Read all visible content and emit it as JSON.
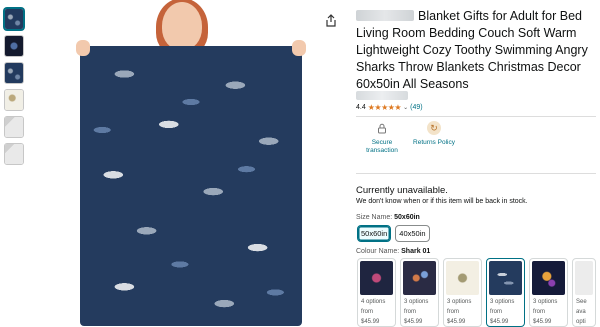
{
  "product": {
    "title": "Blanket Gifts for Adult for Bed Living Room Bedding Couch Soft Warm Lightweight Cozy Toothy Swimming Angry Sharks Throw Blankets Christmas Decor 60x50in All Seasons",
    "rating_value": "4.4",
    "rating_stars": "★★★★★",
    "rating_count": "(49)"
  },
  "thumbnails": [
    {
      "icon": "shark-blanket-thumb"
    },
    {
      "icon": "dark-blanket-thumb"
    },
    {
      "icon": "navy-blanket-thumb"
    },
    {
      "icon": "light-blanket-thumb"
    },
    {
      "icon": "grey-blanket-thumb"
    },
    {
      "icon": "detail-thumb"
    }
  ],
  "badges": {
    "secure": "Secure transaction",
    "returns": "Returns Policy"
  },
  "availability": {
    "status": "Currently unavailable.",
    "note": "We don't know when or if this item will be back in stock."
  },
  "size": {
    "label": "Size Name:",
    "selected": "50x60in",
    "options": [
      "50x60in",
      "40x50in"
    ]
  },
  "colour": {
    "label": "Colour Name:",
    "selected": "Shark 01",
    "swatches": [
      {
        "options": "4 options",
        "from": "from",
        "price": "$45.99"
      },
      {
        "options": "3 options",
        "from": "from",
        "price": "$45.99"
      },
      {
        "options": "3 options",
        "from": "from",
        "price": "$45.99"
      },
      {
        "options": "3 options",
        "from": "from",
        "price": "$45.99"
      },
      {
        "options": "3 options",
        "from": "from",
        "price": "$45.99"
      },
      {
        "options": "See",
        "from": "ava",
        "price": "opti"
      }
    ]
  },
  "colors": {
    "accent": "#007185",
    "star": "#de7921",
    "blanket": "#243b5e"
  }
}
